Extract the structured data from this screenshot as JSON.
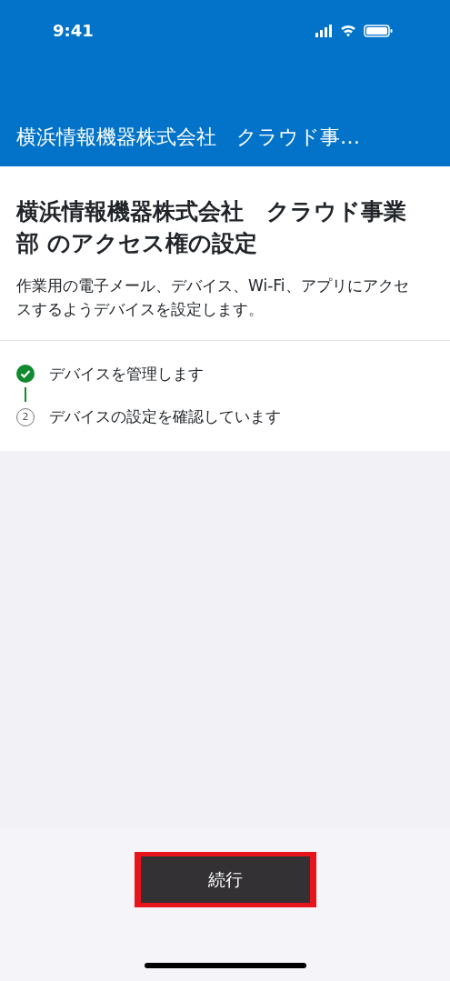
{
  "status_bar": {
    "time": "9:41"
  },
  "header": {
    "title": "横浜情報機器株式会社　クラウド事…"
  },
  "heading": "横浜情報機器株式会社　クラウド事業部 のアクセス権の設定",
  "description": "作業用の電子メール、デバイス、Wi-Fi、アプリにアクセスするようデバイスを設定します。",
  "steps": [
    {
      "label": "デバイスを管理します",
      "done": true
    },
    {
      "label": "デバイスの設定を確認しています",
      "done": false,
      "number": "2"
    }
  ],
  "continue_button": {
    "label": "続行",
    "highlighted": true
  }
}
